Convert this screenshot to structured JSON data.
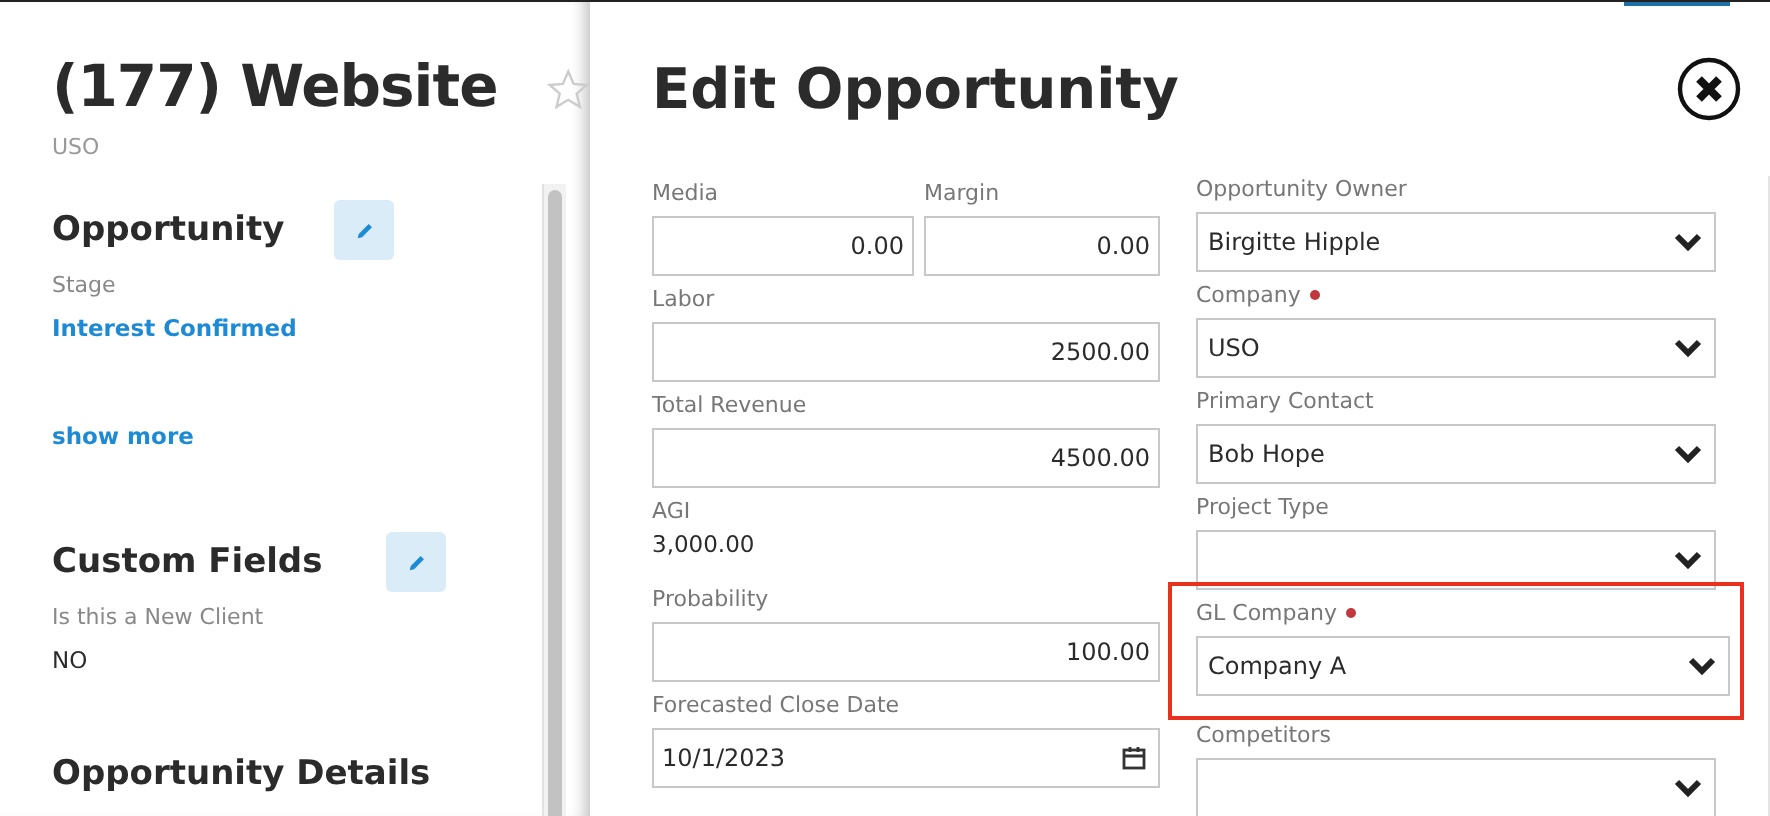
{
  "record": {
    "title": "(177) Website",
    "subtitle": "USO",
    "favorite": false,
    "sections": [
      {
        "heading": "Opportunity",
        "fields": [
          {
            "label": "Stage",
            "value": "Interest Confirmed",
            "kind": "link"
          }
        ],
        "link": "show more"
      },
      {
        "heading": "Custom Fields",
        "fields": [
          {
            "label": "Is this a New Client",
            "value": "NO",
            "kind": "plain"
          }
        ]
      },
      {
        "heading": "Opportunity Details"
      }
    ]
  },
  "modal": {
    "title": "Edit Opportunity",
    "left_fields": [
      {
        "kind": "pair",
        "items": [
          {
            "label": "Media",
            "value": "0.00"
          },
          {
            "label": "Margin",
            "value": "0.00"
          }
        ]
      },
      {
        "kind": "number",
        "label": "Labor",
        "value": "2500.00"
      },
      {
        "kind": "number",
        "label": "Total Revenue",
        "value": "4500.00"
      },
      {
        "kind": "readonly",
        "label": "AGI",
        "value": "3,000.00"
      },
      {
        "kind": "number",
        "label": "Probability",
        "value": "100.00"
      },
      {
        "kind": "date",
        "label": "Forecasted Close Date",
        "value": "10/1/2023"
      }
    ],
    "right_fields": [
      {
        "label": "Opportunity Owner",
        "value": "Birgitte Hipple",
        "required": false,
        "highlighted": false
      },
      {
        "label": "Company",
        "value": "USO",
        "required": true,
        "highlighted": false
      },
      {
        "label": "Primary Contact",
        "value": "Bob Hope",
        "required": false,
        "highlighted": false
      },
      {
        "label": "Project Type",
        "required": false,
        "highlighted": false
      },
      {
        "label": "GL Company",
        "value": "Company A",
        "required": true,
        "highlighted": true
      },
      {
        "label": "Competitors",
        "required": false,
        "highlighted": false
      }
    ]
  }
}
